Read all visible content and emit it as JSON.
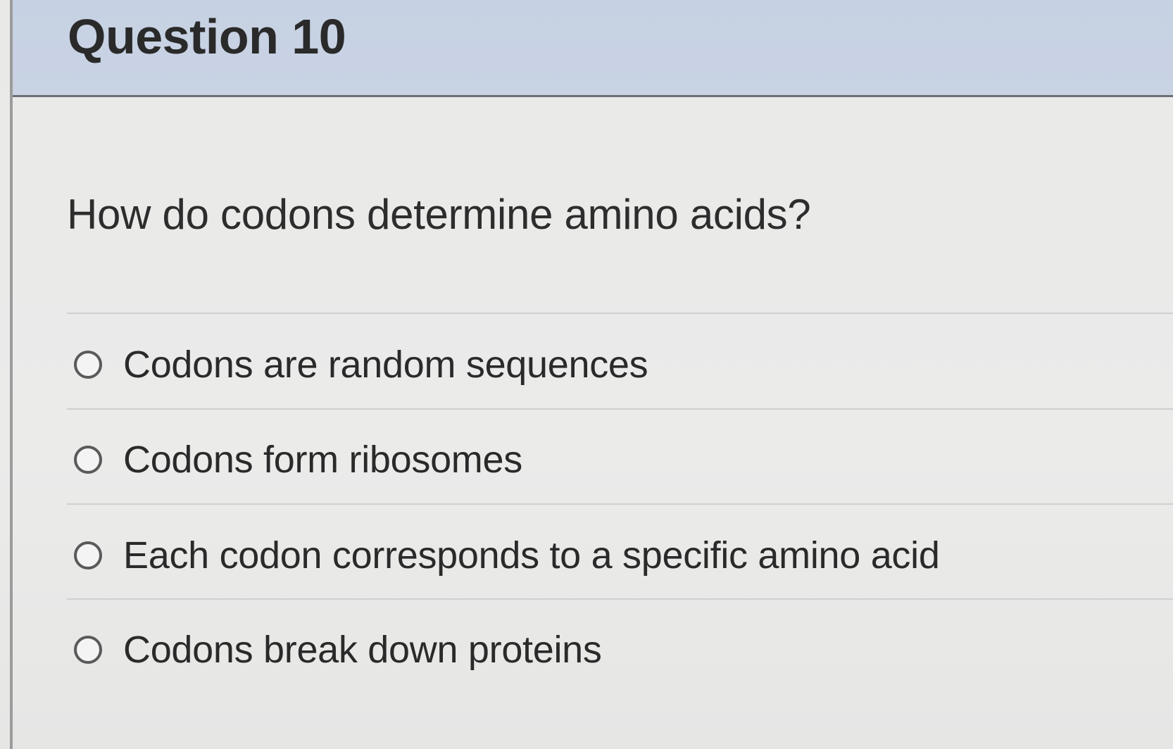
{
  "question": {
    "title": "Question 10",
    "prompt": "How do codons determine amino acids?"
  },
  "options": [
    {
      "label": "Codons are random sequences"
    },
    {
      "label": "Codons form ribosomes"
    },
    {
      "label": "Each codon corresponds to a specific amino acid"
    },
    {
      "label": "Codons break down proteins"
    }
  ]
}
